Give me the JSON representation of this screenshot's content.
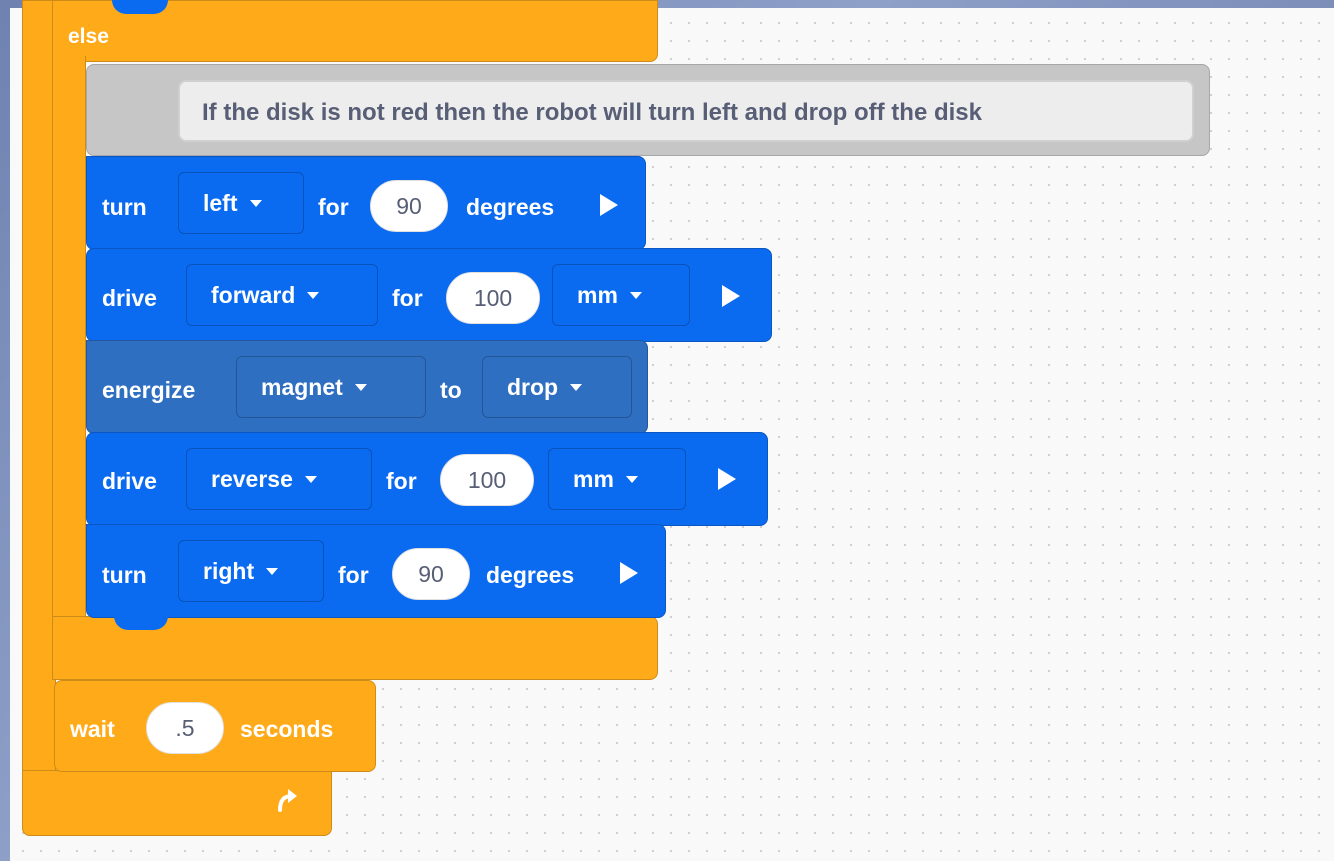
{
  "else_block": {
    "label": "else"
  },
  "comment_block": {
    "text": "If the disk is not red then the robot will turn left and drop off the disk"
  },
  "turn_left": {
    "verb": "turn",
    "direction": "left",
    "for_label": "for",
    "amount": "90",
    "unit": "degrees"
  },
  "drive_forward": {
    "verb": "drive",
    "direction": "forward",
    "for_label": "for",
    "amount": "100",
    "unit": "mm"
  },
  "energize": {
    "verb": "energize",
    "target": "magnet",
    "to_label": "to",
    "action": "drop"
  },
  "drive_reverse": {
    "verb": "drive",
    "direction": "reverse",
    "for_label": "for",
    "amount": "100",
    "unit": "mm"
  },
  "turn_right": {
    "verb": "turn",
    "direction": "right",
    "for_label": "for",
    "amount": "90",
    "unit": "degrees"
  },
  "wait_block": {
    "verb": "wait",
    "amount": ".5",
    "unit": "seconds"
  },
  "loop_end": {
    "icon": "loop-arrow-icon"
  },
  "colors": {
    "control_orange": "#ffab19",
    "drivetrain_blue": "#0b6bf0",
    "magnet_blue": "#2e6fc2",
    "comment_gray": "#c6c6c6"
  }
}
